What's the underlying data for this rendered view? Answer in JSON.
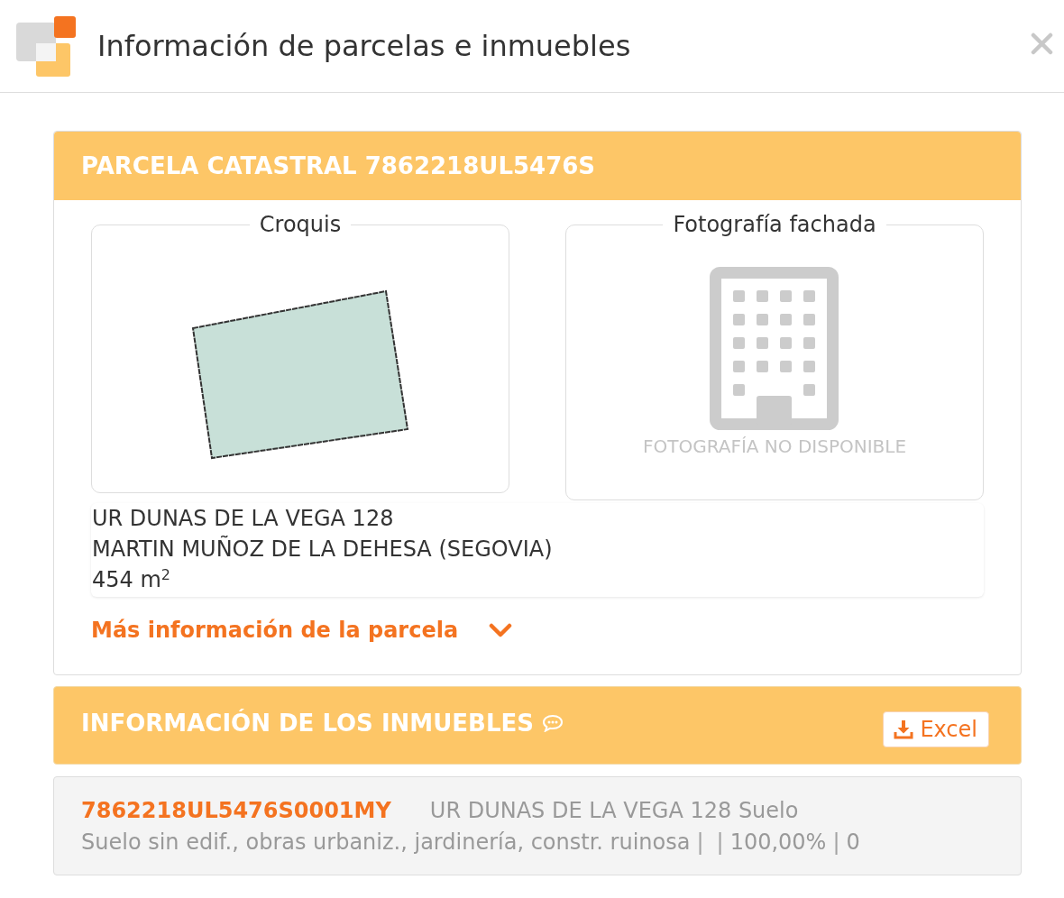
{
  "window": {
    "title": "Información de parcelas e inmuebles"
  },
  "parcel": {
    "title": "PARCELA CATASTRAL 7862218UL5476S",
    "sketch": {
      "legend": "Croquis"
    },
    "photo": {
      "legend": "Fotografía fachada",
      "message": "FOTOGRAFÍA NO DISPONIBLE"
    },
    "address_lines": [
      "UR DUNAS DE LA VEGA 128",
      "MARTIN MUÑOZ DE LA DEHESA (SEGOVIA)",
      "454 m$^{2}$"
    ],
    "more_link": {
      "label": "Más información de la parcela",
      "expanded": false
    }
  },
  "properties": {
    "title": "INFORMACIÓN DE LOS INMUEBLES",
    "export_button": {
      "label": "Excel"
    },
    "items": [
      {
        "reference": "7862218UL5476S0001MY",
        "address": "UR DUNAS DE LA VEGA 128 Suelo",
        "details": [
          {
            "kind": "text",
            "text": "Suelo sin edif., obras urbaniz., jardinería, constr. ruinosa"
          },
          {
            "kind": "separator",
            "text": "|"
          },
          {
            "kind": "separator",
            "text": "|"
          },
          {
            "kind": "text",
            "text": "100,00%"
          },
          {
            "kind": "separator",
            "text": "|"
          },
          {
            "kind": "text",
            "text": "0"
          }
        ]
      }
    ]
  }
}
